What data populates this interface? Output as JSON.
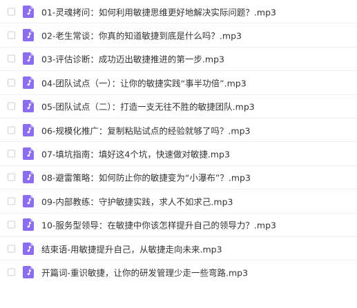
{
  "colors": {
    "icon_bg": "#8c6df2",
    "icon_fold": "#b7a4f7",
    "text": "#333333",
    "divider": "#eeeeee",
    "checkbox_border": "#cfcfcf"
  },
  "files": [
    {
      "name": "01-灵魂拷问：如何利用敏捷思维更好地解决实际问题？.mp3",
      "icon": "music-file-icon"
    },
    {
      "name": "02-老生常谈：你真的知道敏捷到底是什么吗？.mp3",
      "icon": "music-file-icon"
    },
    {
      "name": "03-评估诊断：成功迈出敏捷推进的第一步.mp3",
      "icon": "music-file-icon"
    },
    {
      "name": "04-团队试点（一）：让你的敏捷实践“事半功倍”.mp3",
      "icon": "music-file-icon"
    },
    {
      "name": "05-团队试点（二）：打造一支无往不胜的敏捷团队.mp3",
      "icon": "music-file-icon"
    },
    {
      "name": "06-规模化推广：复制粘贴试点的经验就够了吗？.mp3",
      "icon": "music-file-icon"
    },
    {
      "name": "07-填坑指南：填好这4个坑，快速做对敏捷.mp3",
      "icon": "music-file-icon"
    },
    {
      "name": "08-避雷策略：如何防止你的敏捷变为“小瀑布”？.mp3",
      "icon": "music-file-icon"
    },
    {
      "name": "09-内部教练：守护敏捷实践，求人不如求己.mp3",
      "icon": "music-file-icon"
    },
    {
      "name": "10-服务型领导：在敏捷中你该怎样提升自己的领导力？.mp3",
      "icon": "music-file-icon"
    },
    {
      "name": "结束语-用敏捷提升自己，从敏捷走向未来.mp3",
      "icon": "music-file-icon"
    },
    {
      "name": "开篇词-重识敏捷，让你的研发管理少走一些弯路.mp3",
      "icon": "music-file-icon"
    }
  ]
}
